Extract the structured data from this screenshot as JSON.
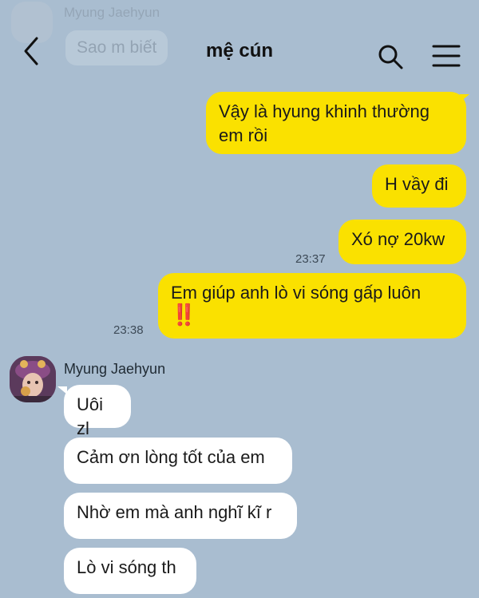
{
  "ghost": {
    "sender": "Myung Jaehyun",
    "message": "Sao m biết"
  },
  "header": {
    "title": "mệ cún",
    "back_icon": "chevron-left-icon",
    "search_icon": "search-icon",
    "menu_icon": "hamburger-menu-icon"
  },
  "messages_out": [
    {
      "text": "Vậy là hyung khinh thường em rồi"
    },
    {
      "text": "H vầy đi"
    },
    {
      "text": "Xó nợ 20kw",
      "time": "23:37"
    },
    {
      "text": "Em giúp anh lò vi sóng gấp luôn",
      "emoji": "‼️",
      "time": "23:38"
    }
  ],
  "incoming": {
    "sender": "Myung Jaehyun",
    "messages": [
      {
        "text": "Uôi zl"
      },
      {
        "text": "Cảm ơn lòng tốt của em"
      },
      {
        "text": "Nhờ em mà anh nghĩ kĩ r"
      },
      {
        "text": "Lò vi sóng th"
      }
    ]
  },
  "colors": {
    "background": "#a9bdd0",
    "outgoing_bubble": "#fae100",
    "incoming_bubble": "#ffffff"
  }
}
